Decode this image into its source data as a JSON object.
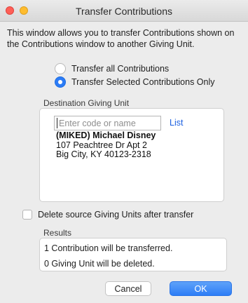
{
  "window": {
    "title": "Transfer Contributions"
  },
  "intro_text": "This window allows you to transfer Contributions shown on the Contributions window to another Giving Unit.",
  "transfer_options": {
    "all_label": "Transfer all Contributions",
    "selected_label": "Transfer Selected Contributions Only",
    "selected": "selected"
  },
  "destination": {
    "group_label": "Destination Giving Unit",
    "search_placeholder": "Enter code or name",
    "search_value": "",
    "list_label": "List",
    "name": "(MIKED) Michael Disney",
    "address_line1": "107 Peachtree Dr  Apt 2",
    "address_line2": "Big City, KY  40123-2318"
  },
  "delete_source": {
    "label": "Delete source Giving Units after transfer",
    "checked": false
  },
  "results": {
    "group_label": "Results",
    "lines": [
      "1 Contribution will be transferred.",
      "0 Giving Unit will be deleted."
    ]
  },
  "buttons": {
    "cancel": "Cancel",
    "ok": "OK"
  },
  "colors": {
    "accent": "#2c7cf6",
    "link": "#1a5fe0",
    "close": "#fe5f57",
    "minimize": "#febc2e"
  }
}
